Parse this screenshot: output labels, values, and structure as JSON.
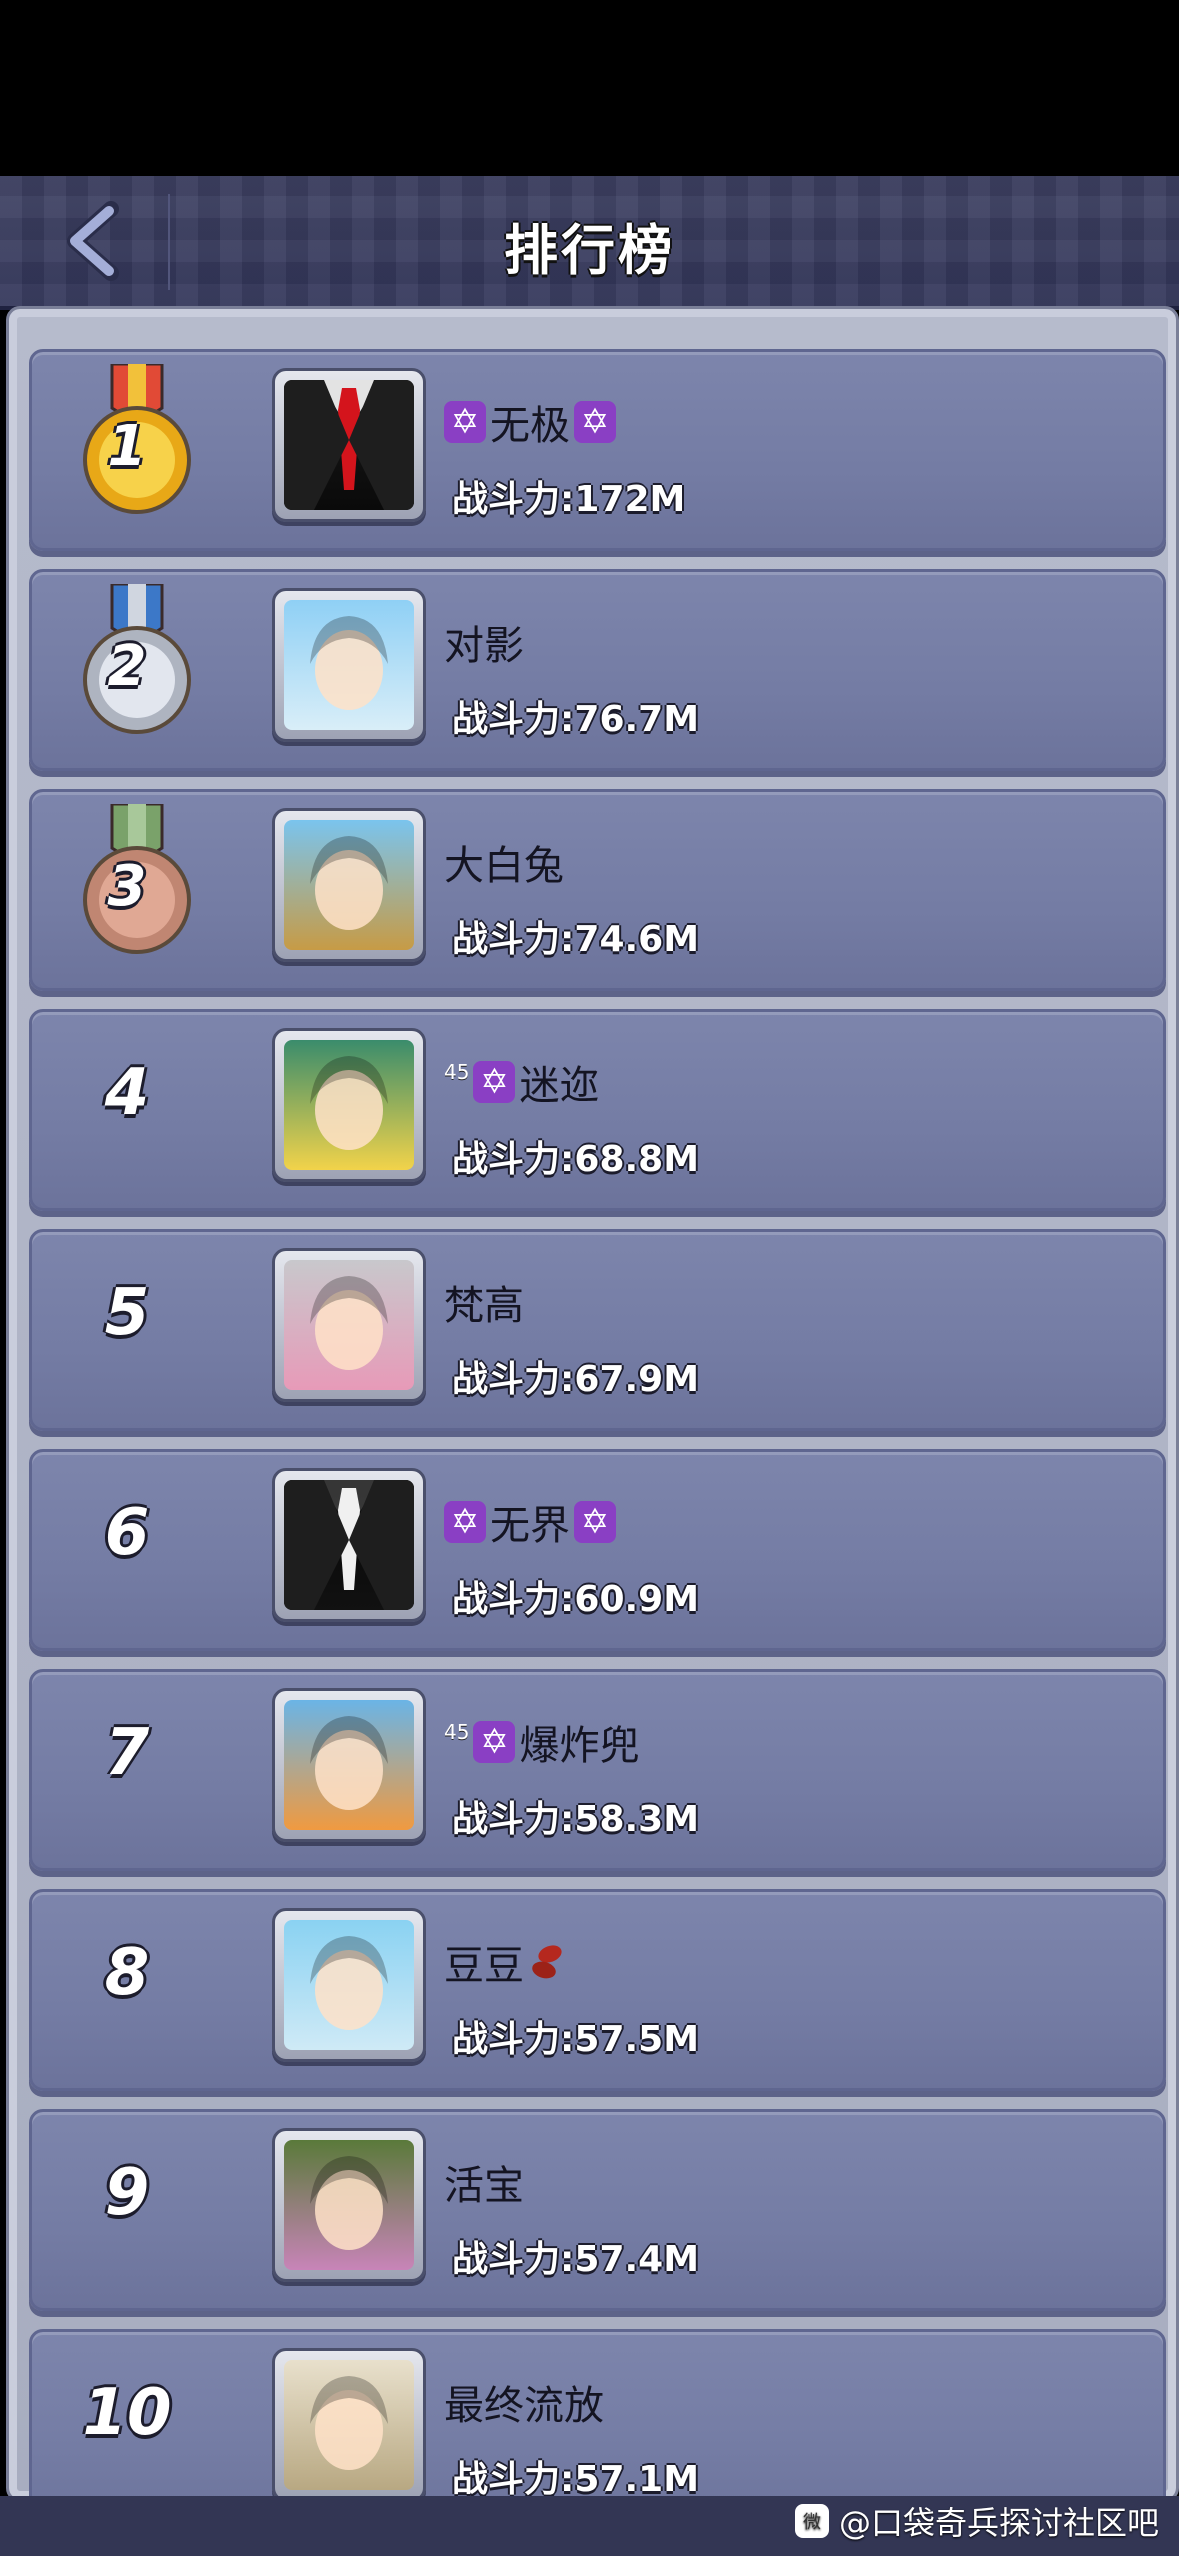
{
  "header": {
    "title": "排行榜"
  },
  "rows": [
    {
      "rank": "1",
      "medal": "gold",
      "name": "无极",
      "badge_left": "✡",
      "badge_right": "✡",
      "level": "",
      "power_label": "战斗力:",
      "power": "172M",
      "avatar": "black-suit-red-tie"
    },
    {
      "rank": "2",
      "medal": "silver",
      "name": "对影",
      "badge_left": "",
      "badge_right": "",
      "level": "",
      "power_label": "战斗力:",
      "power": "76.7M",
      "avatar": "blue-hair-girl"
    },
    {
      "rank": "3",
      "medal": "bronze",
      "name": "大白兔",
      "badge_left": "",
      "badge_right": "",
      "level": "",
      "power_label": "战斗力:",
      "power": "74.6M",
      "avatar": "yellow-bear"
    },
    {
      "rank": "4",
      "medal": "",
      "name": "迷迩",
      "badge_left": "✡",
      "badge_right": "",
      "level": "45",
      "power_label": "战斗力:",
      "power": "68.8M",
      "avatar": "blonde-goggles-girl"
    },
    {
      "rank": "5",
      "medal": "",
      "name": "梵高",
      "badge_left": "",
      "badge_right": "",
      "level": "",
      "power_label": "战斗力:",
      "power": "67.9M",
      "avatar": "pink-hair-helmet-girl"
    },
    {
      "rank": "6",
      "medal": "",
      "name": "无界",
      "badge_left": "✡",
      "badge_right": "✡",
      "level": "",
      "power_label": "战斗力:",
      "power": "60.9M",
      "avatar": "black-suit-white-tie"
    },
    {
      "rank": "7",
      "medal": "",
      "name": "爆炸兜",
      "badge_left": "✡",
      "badge_right": "",
      "level": "45",
      "power_label": "战斗力:",
      "power": "58.3M",
      "avatar": "orange-hair-boy"
    },
    {
      "rank": "8",
      "medal": "",
      "name": "豆豆",
      "badge_left": "",
      "badge_right": "",
      "level": "",
      "power_label": "战斗力:",
      "power": "57.5M",
      "avatar": "bob-hair-girl",
      "suffix_icon": "beans-icon"
    },
    {
      "rank": "9",
      "medal": "",
      "name": "活宝",
      "badge_left": "",
      "badge_right": "",
      "level": "",
      "power_label": "战斗力:",
      "power": "57.4M",
      "avatar": "purple-hair-monocle-girl"
    },
    {
      "rank": "10",
      "medal": "",
      "name": "最终流放",
      "badge_left": "",
      "badge_right": "",
      "level": "",
      "power_label": "战斗力:",
      "power": "57.1M",
      "avatar": "soldier-sketch"
    }
  ],
  "watermark": {
    "icon": "微",
    "text": "@口袋奇兵探讨社区吧"
  },
  "colors": {
    "header": "#3a3d60",
    "row": "#767ea6",
    "badge": "#8a3fc4"
  }
}
